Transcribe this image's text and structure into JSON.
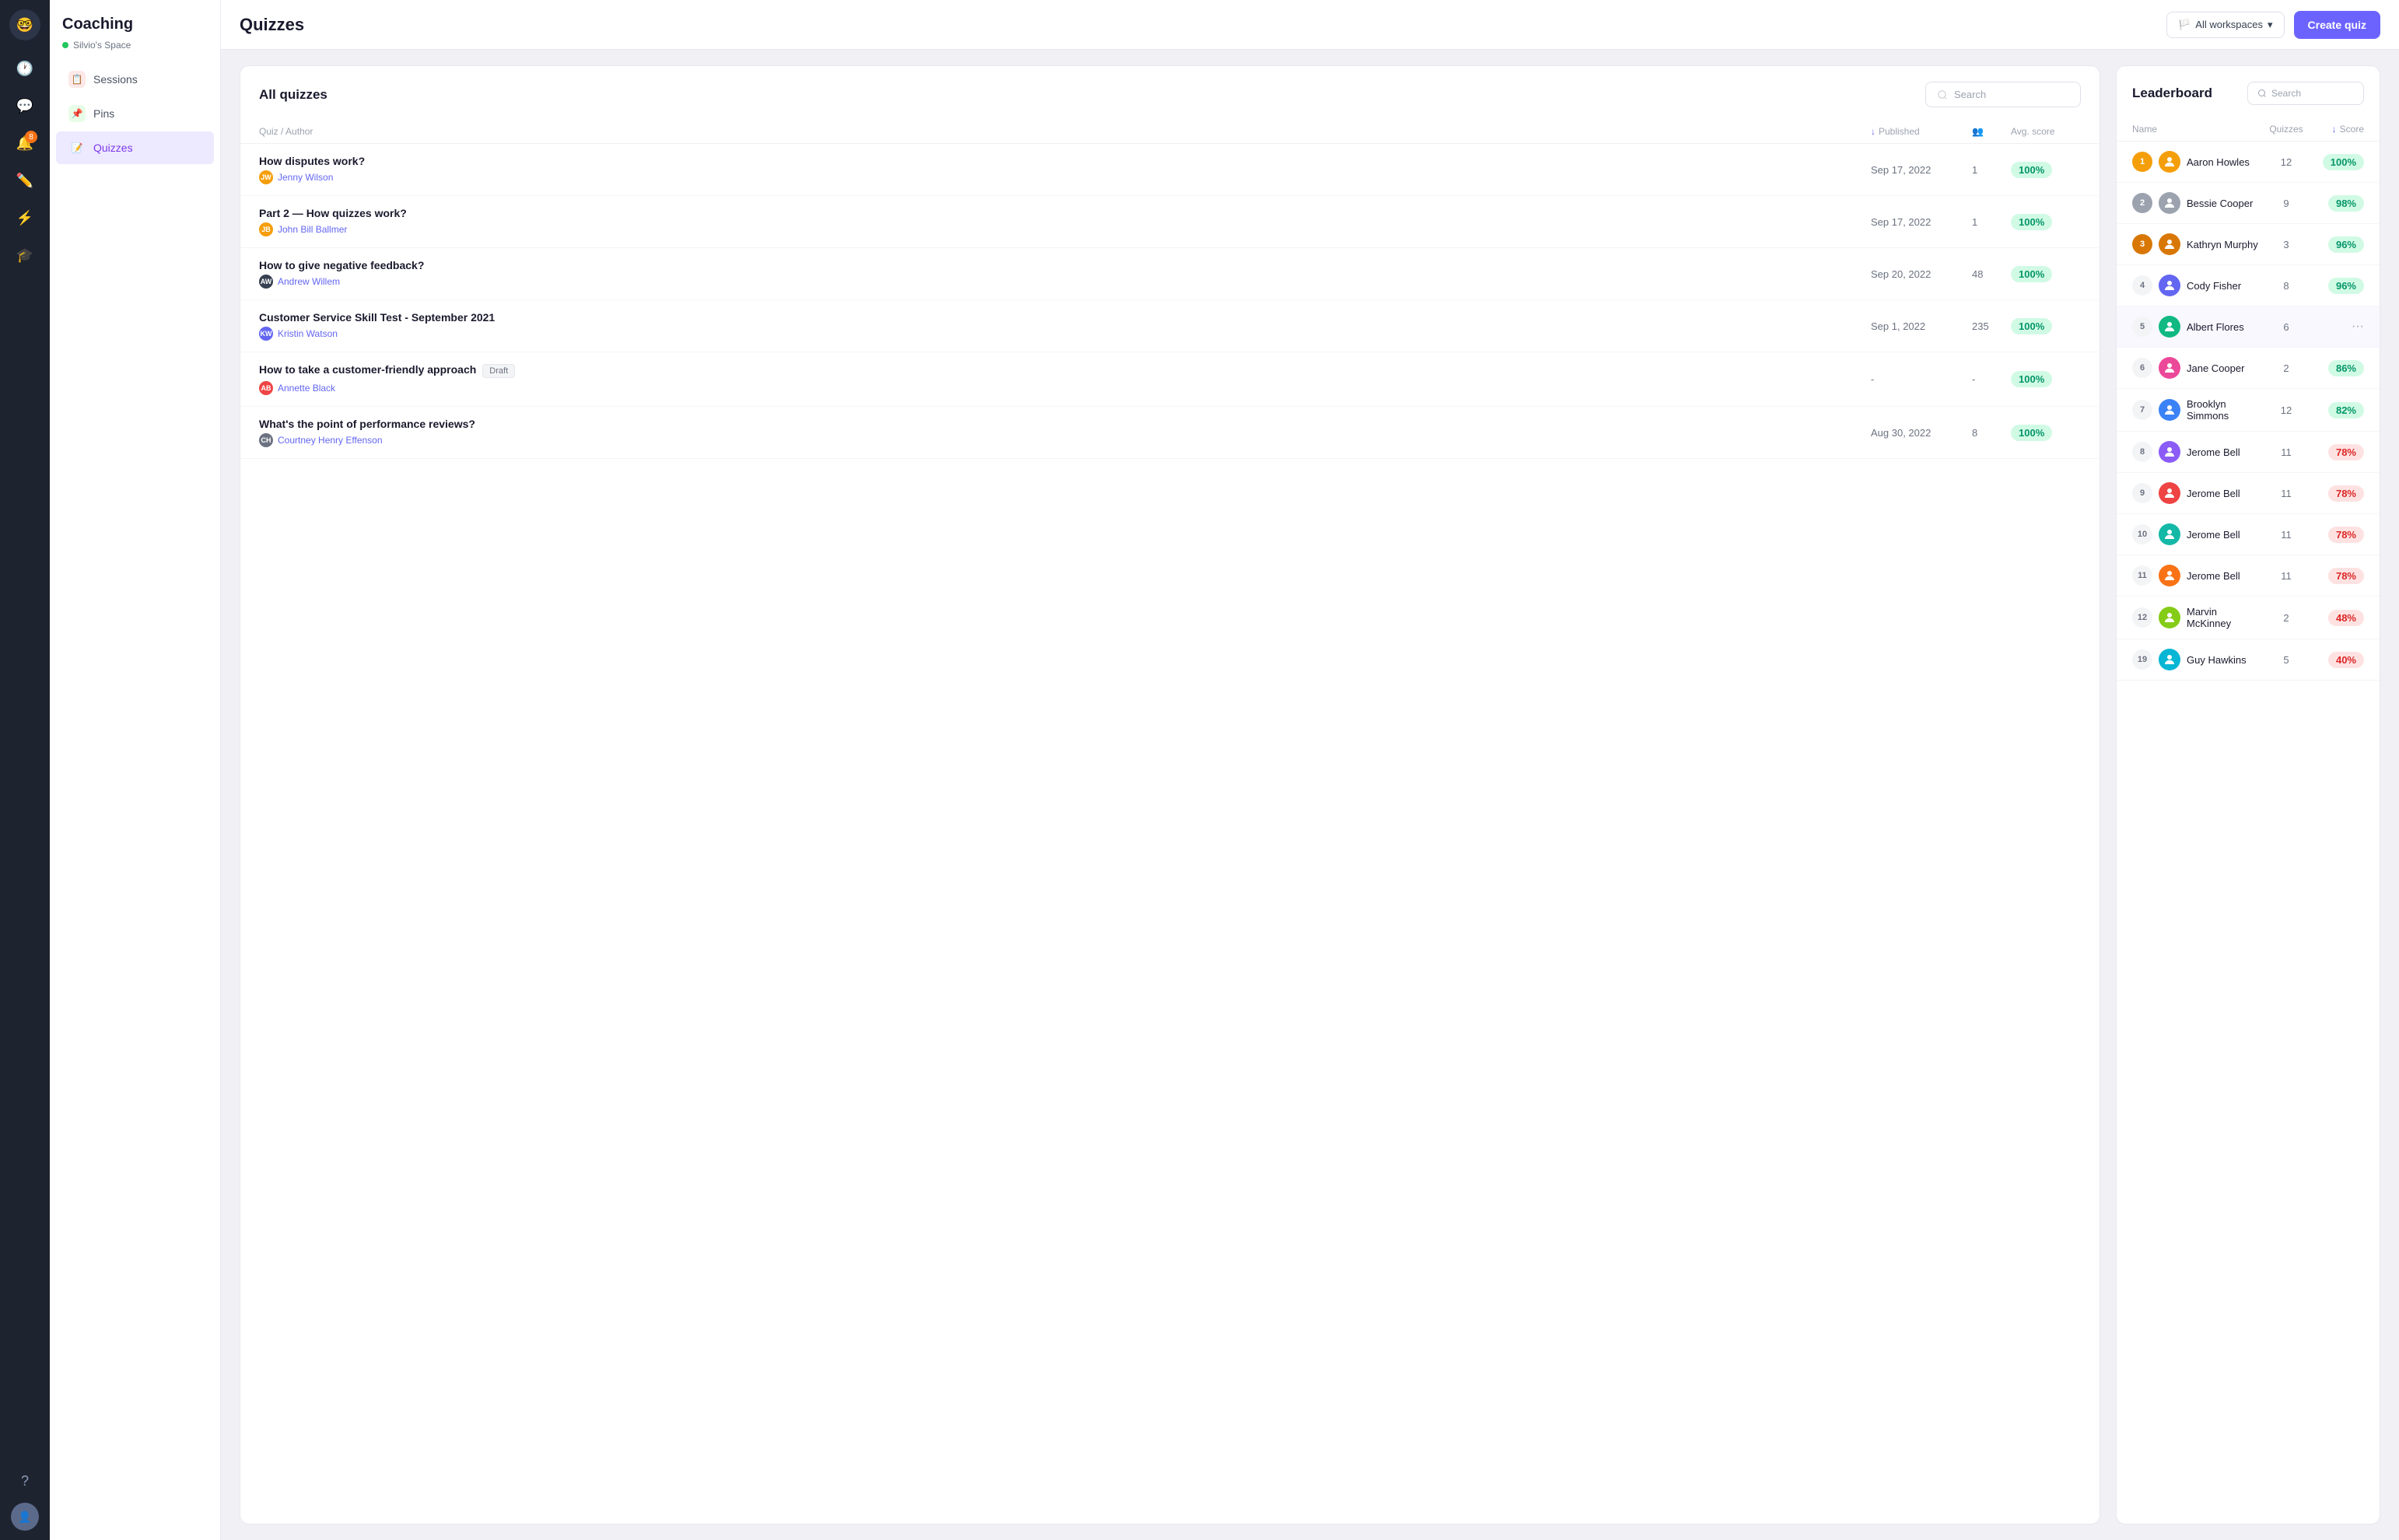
{
  "app": {
    "logo": "🤓",
    "brand": "Coaching",
    "space": "Silvio's Space",
    "page_title": "Quizzes"
  },
  "sidebar_dark": {
    "nav_items": [
      {
        "icon": "🕐",
        "label": "activity-icon",
        "badge": null
      },
      {
        "icon": "💬",
        "label": "messages-icon",
        "badge": null
      },
      {
        "icon": "8",
        "label": "notifications-icon",
        "badge": "8"
      },
      {
        "icon": "✏️",
        "label": "edit-icon",
        "badge": null
      },
      {
        "icon": "⚡",
        "label": "lightning-icon",
        "badge": null
      },
      {
        "icon": "🎓",
        "label": "graduation-icon",
        "badge": null
      }
    ],
    "bottom_items": [
      {
        "icon": "?",
        "label": "help-icon"
      }
    ]
  },
  "left_nav": {
    "items": [
      {
        "label": "Sessions",
        "icon_color": "#fde8e8",
        "icon_bg": "sessions",
        "active": false
      },
      {
        "label": "Pins",
        "icon_color": "#e8fde8",
        "icon_bg": "pins",
        "active": false
      },
      {
        "label": "Quizzes",
        "icon_color": "#ede9fe",
        "icon_bg": "quizzes",
        "active": true
      }
    ]
  },
  "top_bar": {
    "workspace_label": "All workspaces",
    "create_button": "Create quiz"
  },
  "quizzes_panel": {
    "title": "All quizzes",
    "search_placeholder": "Search",
    "columns": {
      "quiz_author": "Quiz / Author",
      "published": "Published",
      "participants": "",
      "avg_score": "Avg. score"
    },
    "rows": [
      {
        "title": "How disputes work?",
        "author": "Jenny Wilson",
        "author_color": "#f59e0b",
        "author_initials": "JW",
        "date": "Sep 17, 2022",
        "participants": "1",
        "score": "100%",
        "score_type": "green",
        "draft": false
      },
      {
        "title": "Part 2 — How quizzes work?",
        "author": "John Bill Ballmer",
        "author_color": "#f59e0b",
        "author_initials": "JB",
        "date": "Sep 17, 2022",
        "participants": "1",
        "score": "100%",
        "score_type": "green",
        "draft": false
      },
      {
        "title": "How to give negative feedback?",
        "author": "Andrew Willem",
        "author_color": "#374151",
        "author_initials": "AW",
        "date": "Sep 20, 2022",
        "participants": "48",
        "score": "100%",
        "score_type": "green",
        "draft": false
      },
      {
        "title": "Customer Service Skill Test - September 2021",
        "author": "Kristin Watson",
        "author_color": "#374151",
        "author_initials": "KW",
        "date": "Sep 1, 2022",
        "participants": "235",
        "score": "100%",
        "score_type": "green",
        "draft": false
      },
      {
        "title": "How to take a customer-friendly approach",
        "author": "Annette Black",
        "author_color": "#ef4444",
        "author_initials": "AB",
        "date": "-",
        "participants": "-",
        "score": "100%",
        "score_type": "green",
        "draft": true
      },
      {
        "title": "What's the point of performance reviews?",
        "author": "Courtney Henry Effenson",
        "author_color": "#374151",
        "author_initials": "CH",
        "date": "Aug 30, 2022",
        "participants": "8",
        "score": "100%",
        "score_type": "green",
        "draft": false
      }
    ]
  },
  "leaderboard": {
    "title": "Leaderboard",
    "search_placeholder": "Search",
    "columns": {
      "name": "Name",
      "quizzes": "Quizzes",
      "score": "Score"
    },
    "rows": [
      {
        "rank": "1",
        "rank_type": "gold",
        "name": "Aaron Howles",
        "quizzes": "12",
        "score": "100%",
        "score_type": "green",
        "highlighted": false
      },
      {
        "rank": "2",
        "rank_type": "silver",
        "name": "Bessie Cooper",
        "quizzes": "9",
        "score": "98%",
        "score_type": "green",
        "highlighted": false
      },
      {
        "rank": "3",
        "rank_type": "bronze",
        "name": "Kathryn Murphy",
        "quizzes": "3",
        "score": "96%",
        "score_type": "green",
        "highlighted": false
      },
      {
        "rank": "4",
        "rank_type": "other",
        "name": "Cody Fisher",
        "quizzes": "8",
        "score": "96%",
        "score_type": "green",
        "highlighted": false
      },
      {
        "rank": "5",
        "rank_type": "other",
        "name": "Albert Flores",
        "quizzes": "6",
        "score": "···",
        "score_type": "dots",
        "highlighted": true
      },
      {
        "rank": "6",
        "rank_type": "other",
        "name": "Jane Cooper",
        "quizzes": "2",
        "score": "86%",
        "score_type": "green",
        "highlighted": false
      },
      {
        "rank": "7",
        "rank_type": "other",
        "name": "Brooklyn Simmons",
        "quizzes": "12",
        "score": "82%",
        "score_type": "green",
        "highlighted": false
      },
      {
        "rank": "8",
        "rank_type": "other",
        "name": "Jerome Bell",
        "quizzes": "11",
        "score": "78%",
        "score_type": "red",
        "highlighted": false
      },
      {
        "rank": "9",
        "rank_type": "other",
        "name": "Jerome Bell",
        "quizzes": "11",
        "score": "78%",
        "score_type": "red",
        "highlighted": false
      },
      {
        "rank": "10",
        "rank_type": "other",
        "name": "Jerome Bell",
        "quizzes": "11",
        "score": "78%",
        "score_type": "red",
        "highlighted": false
      },
      {
        "rank": "11",
        "rank_type": "other",
        "name": "Jerome Bell",
        "quizzes": "11",
        "score": "78%",
        "score_type": "red",
        "highlighted": false
      },
      {
        "rank": "12",
        "rank_type": "other",
        "name": "Marvin McKinney",
        "quizzes": "2",
        "score": "48%",
        "score_type": "red",
        "highlighted": false
      },
      {
        "rank": "19",
        "rank_type": "other",
        "name": "Guy Hawkins",
        "quizzes": "5",
        "score": "40%",
        "score_type": "red",
        "highlighted": false
      }
    ]
  }
}
